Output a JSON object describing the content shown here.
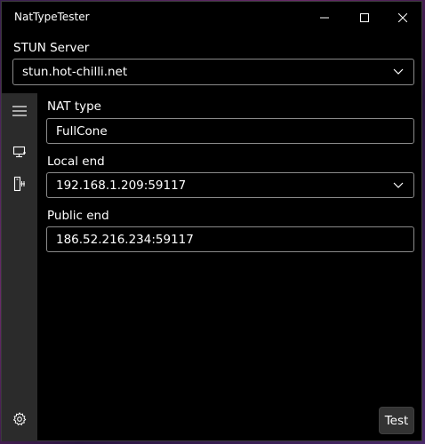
{
  "window": {
    "title": "NatTypeTester"
  },
  "stun": {
    "label": "STUN Server",
    "value": "stun.hot-chilli.net"
  },
  "fields": {
    "nat_type": {
      "label": "NAT type",
      "value": "FullCone"
    },
    "local_end": {
      "label": "Local end",
      "value": "192.168.1.209:59117"
    },
    "public_end": {
      "label": "Public end",
      "value": "186.52.216.234:59117"
    }
  },
  "nav": {
    "items": [
      {
        "icon": "hamburger-menu-icon"
      },
      {
        "icon": "monitor-icon"
      },
      {
        "icon": "server-plug-icon"
      }
    ],
    "footer_icon": "settings-gear-icon"
  },
  "actions": {
    "test_label": "Test"
  },
  "colors": {
    "background": "#000000",
    "nav_pane": "#2b2b2b",
    "border": "#8a8a8a",
    "text": "#ffffff"
  }
}
